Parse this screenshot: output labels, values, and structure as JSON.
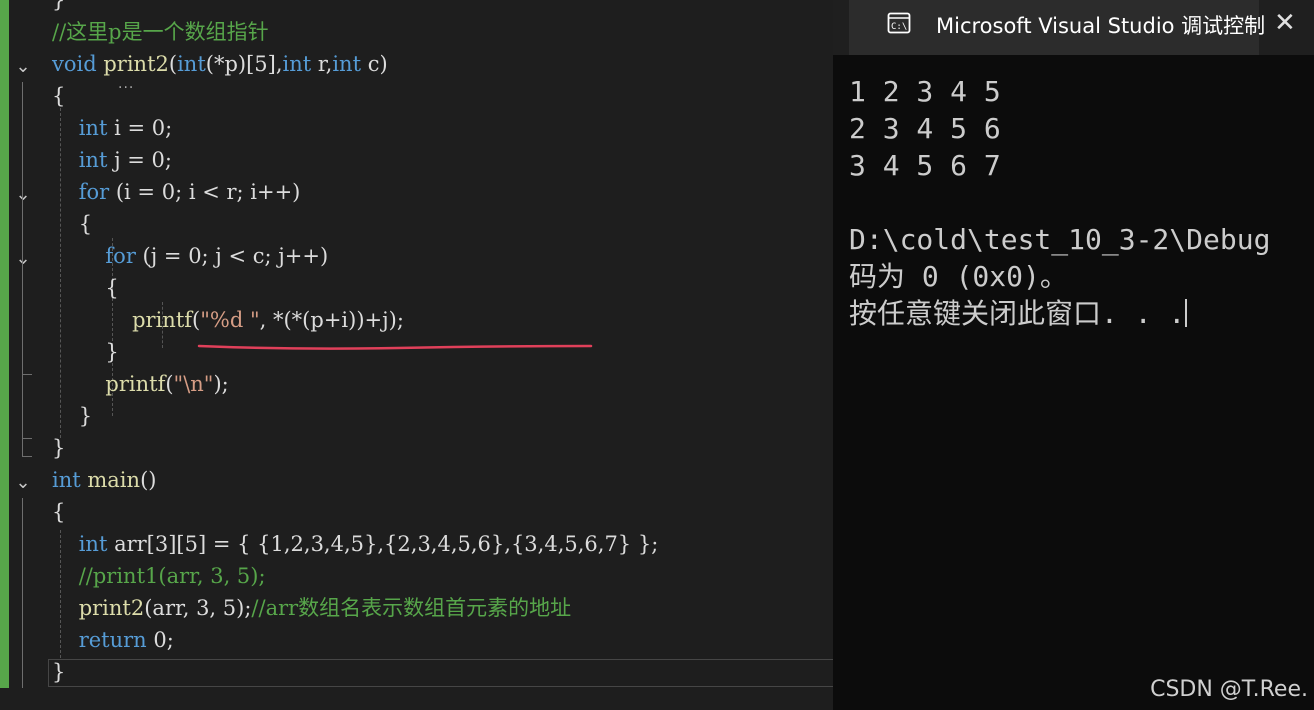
{
  "editor": {
    "lines": [
      {
        "tokens": [
          {
            "t": "}",
            "c": "id"
          }
        ]
      },
      {
        "tokens": [
          {
            "t": "//这里p是一个数组指针",
            "c": "cm"
          }
        ]
      },
      {
        "tokens": [
          {
            "t": "void",
            "c": "kw"
          },
          {
            "t": " ",
            "c": "id"
          },
          {
            "t": "print2",
            "c": "fn"
          },
          {
            "t": "(",
            "c": "id"
          },
          {
            "t": "int",
            "c": "kw"
          },
          {
            "t": "(*p)[5],",
            "c": "id"
          },
          {
            "t": "int",
            "c": "kw"
          },
          {
            "t": " r,",
            "c": "id"
          },
          {
            "t": "int",
            "c": "kw"
          },
          {
            "t": " c)",
            "c": "id"
          }
        ]
      },
      {
        "tokens": [
          {
            "t": "{",
            "c": "id"
          }
        ]
      },
      {
        "tokens": [
          {
            "t": "    ",
            "c": "id"
          },
          {
            "t": "int",
            "c": "kw"
          },
          {
            "t": " i = 0;",
            "c": "id"
          }
        ]
      },
      {
        "tokens": [
          {
            "t": "    ",
            "c": "id"
          },
          {
            "t": "int",
            "c": "kw"
          },
          {
            "t": " j = 0;",
            "c": "id"
          }
        ]
      },
      {
        "tokens": [
          {
            "t": "    ",
            "c": "id"
          },
          {
            "t": "for",
            "c": "kw"
          },
          {
            "t": " (i = 0; i < r; i++)",
            "c": "id"
          }
        ]
      },
      {
        "tokens": [
          {
            "t": "    {",
            "c": "id"
          }
        ]
      },
      {
        "tokens": [
          {
            "t": "        ",
            "c": "id"
          },
          {
            "t": "for",
            "c": "kw"
          },
          {
            "t": " (j = 0; j < c; j++)",
            "c": "id"
          }
        ]
      },
      {
        "tokens": [
          {
            "t": "        {",
            "c": "id"
          }
        ]
      },
      {
        "tokens": [
          {
            "t": "            ",
            "c": "id"
          },
          {
            "t": "printf",
            "c": "fn"
          },
          {
            "t": "(",
            "c": "id"
          },
          {
            "t": "\"%d \"",
            "c": "st"
          },
          {
            "t": ", *(*(p+i))+j);",
            "c": "id"
          }
        ]
      },
      {
        "tokens": [
          {
            "t": "        }",
            "c": "id"
          }
        ]
      },
      {
        "tokens": [
          {
            "t": "        ",
            "c": "id"
          },
          {
            "t": "printf",
            "c": "fn"
          },
          {
            "t": "(",
            "c": "id"
          },
          {
            "t": "\"\\n\"",
            "c": "st"
          },
          {
            "t": ");",
            "c": "id"
          }
        ]
      },
      {
        "tokens": [
          {
            "t": "    }",
            "c": "id"
          }
        ]
      },
      {
        "tokens": [
          {
            "t": "}",
            "c": "id"
          }
        ]
      },
      {
        "tokens": [
          {
            "t": "int",
            "c": "kw"
          },
          {
            "t": " ",
            "c": "id"
          },
          {
            "t": "main",
            "c": "fn"
          },
          {
            "t": "()",
            "c": "id"
          }
        ]
      },
      {
        "tokens": [
          {
            "t": "{",
            "c": "id"
          }
        ]
      },
      {
        "tokens": [
          {
            "t": "    ",
            "c": "id"
          },
          {
            "t": "int",
            "c": "kw"
          },
          {
            "t": " arr[3][5] = { {1,2,3,4,5},{2,3,4,5,6},{3,4,5,6,7} };",
            "c": "id"
          }
        ]
      },
      {
        "tokens": [
          {
            "t": "    ",
            "c": "id"
          },
          {
            "t": "//print1(arr, 3, 5);",
            "c": "cm"
          }
        ]
      },
      {
        "tokens": [
          {
            "t": "    ",
            "c": "id"
          },
          {
            "t": "print2",
            "c": "fn"
          },
          {
            "t": "(arr, 3, 5);",
            "c": "id"
          },
          {
            "t": "//arr数组名表示数组首元素的地址",
            "c": "cm"
          }
        ]
      },
      {
        "tokens": [
          {
            "t": "    ",
            "c": "id"
          },
          {
            "t": "return",
            "c": "kw"
          },
          {
            "t": " 0;",
            "c": "id"
          }
        ]
      },
      {
        "tokens": [
          {
            "t": "}",
            "c": "id"
          }
        ]
      }
    ]
  },
  "console": {
    "title": "Microsoft Visual Studio 调试控制台",
    "close_glyph": "✕",
    "output_lines": [
      "1 2 3 4 5",
      "2 3 4 5 6",
      "3 4 5 6 7",
      "",
      "D:\\cold\\test_10_3-2\\Debug",
      "码为 0 (0x0)。",
      "按任意键关闭此窗口. . ."
    ]
  },
  "watermark": "CSDN @T.Ree.",
  "colors": {
    "keyword": "#569cd6",
    "comment": "#57a64a",
    "function": "#dcdcaa",
    "string": "#d69d85",
    "text": "#dcdcdc",
    "squiggle": "#e0405a"
  }
}
